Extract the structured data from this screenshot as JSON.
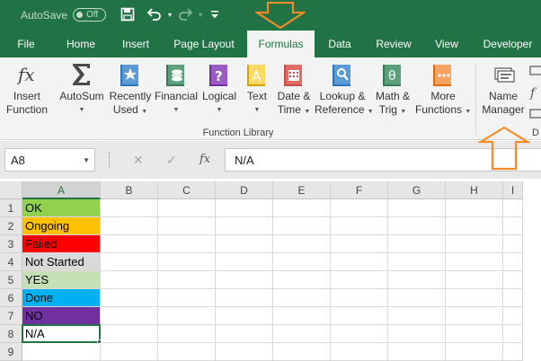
{
  "title_bar": {
    "autosave_label": "AutoSave",
    "autosave_state": "Off",
    "icons": [
      "save-icon",
      "undo-icon",
      "redo-icon",
      "customize-icon"
    ]
  },
  "tabs": [
    {
      "label": "File"
    },
    {
      "label": "Home"
    },
    {
      "label": "Insert"
    },
    {
      "label": "Page Layout"
    },
    {
      "label": "Formulas",
      "active": true
    },
    {
      "label": "Data"
    },
    {
      "label": "Review"
    },
    {
      "label": "View"
    },
    {
      "label": "Developer"
    }
  ],
  "ribbon": {
    "group_label": "Function Library",
    "buttons": [
      {
        "line1": "Insert",
        "line2": "Function",
        "icon": "insert-function-icon",
        "dropdown": false
      },
      {
        "line1": "AutoSum",
        "line2": "",
        "icon": "autosum-icon",
        "dropdown": true
      },
      {
        "line1": "Recently",
        "line2": "Used",
        "icon": "recently-used-icon",
        "dropdown": true
      },
      {
        "line1": "Financial",
        "line2": "",
        "icon": "financial-icon",
        "dropdown": true
      },
      {
        "line1": "Logical",
        "line2": "",
        "icon": "logical-icon",
        "dropdown": true
      },
      {
        "line1": "Text",
        "line2": "",
        "icon": "text-icon",
        "dropdown": true
      },
      {
        "line1": "Date &",
        "line2": "Time",
        "icon": "date-time-icon",
        "dropdown": true
      },
      {
        "line1": "Lookup &",
        "line2": "Reference",
        "icon": "lookup-reference-icon",
        "dropdown": true
      },
      {
        "line1": "Math &",
        "line2": "Trig",
        "icon": "math-trig-icon",
        "dropdown": true
      },
      {
        "line1": "More",
        "line2": "Functions",
        "icon": "more-functions-icon",
        "dropdown": true
      },
      {
        "line1": "Name",
        "line2": "Manager",
        "icon": "name-manager-icon",
        "dropdown": false
      }
    ],
    "group_label_partial": "D"
  },
  "formula_bar": {
    "name_box": "A8",
    "fx_label": "fx",
    "value": "N/A"
  },
  "grid": {
    "columns": [
      "A",
      "B",
      "C",
      "D",
      "E",
      "F",
      "G",
      "H",
      "I"
    ],
    "rows": [
      "1",
      "2",
      "3",
      "4",
      "5",
      "6",
      "7",
      "8",
      "9"
    ],
    "selected_column": "A",
    "cells": [
      {
        "row": "1",
        "text": "OK",
        "fill": "#92d050",
        "color": "#000000"
      },
      {
        "row": "2",
        "text": "Ongoing",
        "fill": "#ffc000",
        "color": "#000000"
      },
      {
        "row": "3",
        "text": "Failed",
        "fill": "#ff0000",
        "color": "#000000"
      },
      {
        "row": "4",
        "text": "Not Started",
        "fill": "#d9d9d9",
        "color": "#000000"
      },
      {
        "row": "5",
        "text": "YES",
        "fill": "#c5e0b4",
        "color": "#000000"
      },
      {
        "row": "6",
        "text": "Done",
        "fill": "#00b0f0",
        "color": "#000000"
      },
      {
        "row": "7",
        "text": "NO",
        "fill": "#7030a0",
        "color": "#000000"
      },
      {
        "row": "8",
        "text": "N/A",
        "fill": "#ffffff",
        "color": "#000000"
      }
    ]
  },
  "colors": {
    "accent": "#217346",
    "annotation_arrow": "#f28c28"
  }
}
